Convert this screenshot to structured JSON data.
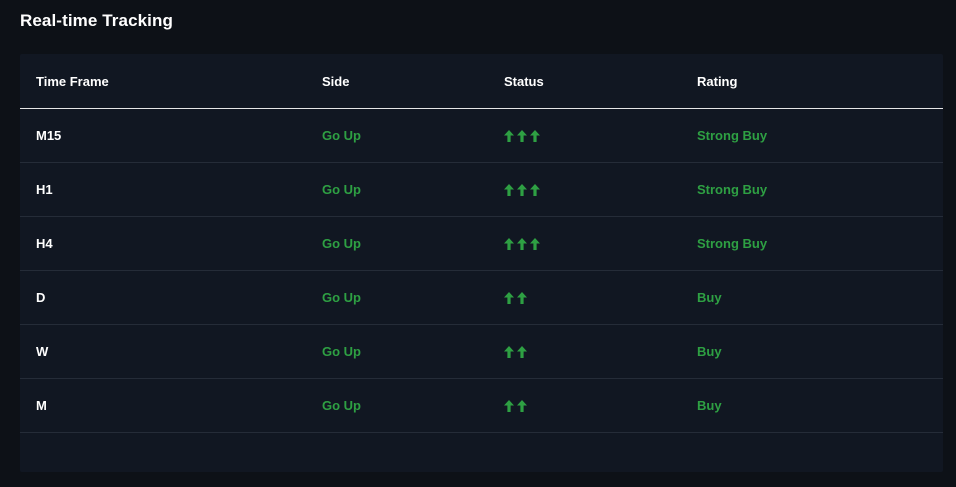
{
  "page": {
    "title": "Real-time Tracking"
  },
  "table": {
    "columns": [
      "Time Frame",
      "Side",
      "Status",
      "Rating"
    ],
    "rows": [
      {
        "timeframe": "M15",
        "side": "Go Up",
        "arrows": 3,
        "rating": "Strong Buy"
      },
      {
        "timeframe": "H1",
        "side": "Go Up",
        "arrows": 3,
        "rating": "Strong Buy"
      },
      {
        "timeframe": "H4",
        "side": "Go Up",
        "arrows": 3,
        "rating": "Strong Buy"
      },
      {
        "timeframe": "D",
        "side": "Go Up",
        "arrows": 2,
        "rating": "Buy"
      },
      {
        "timeframe": "W",
        "side": "Go Up",
        "arrows": 2,
        "rating": "Buy"
      },
      {
        "timeframe": "M",
        "side": "Go Up",
        "arrows": 2,
        "rating": "Buy"
      }
    ]
  },
  "colors": {
    "background": "#0d1117",
    "card": "#111722",
    "accent_green": "#2ea043",
    "header_divider": "#e6e6e6",
    "row_divider": "#252c38"
  },
  "icons": {
    "status": "arrow-up-icon"
  }
}
